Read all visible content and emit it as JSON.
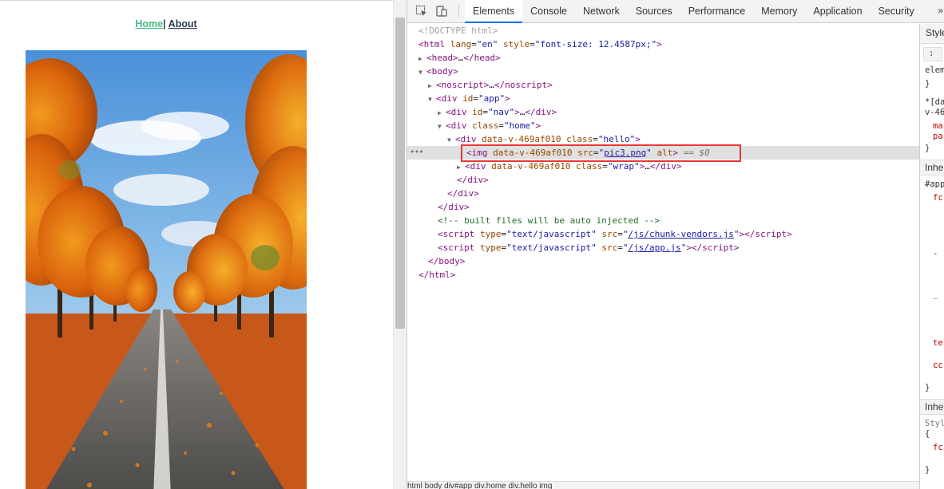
{
  "page": {
    "nav": {
      "home": "Home",
      "separator": "|",
      "about": "About"
    }
  },
  "devtools": {
    "tabs": [
      "Elements",
      "Console",
      "Network",
      "Sources",
      "Performance",
      "Memory",
      "Application",
      "Security"
    ],
    "more": "»",
    "tree": {
      "doctype": "<!DOCTYPE html>",
      "html_tag": "html",
      "html_lang": "en",
      "html_style": "font-size: 12.4587px;",
      "head": "head",
      "body": "body",
      "noscript": "noscript",
      "div": "div",
      "app_id": "app",
      "nav_id": "nav",
      "home_class": "home",
      "hello_attr": "data-v-469af010",
      "hello_class": "hello",
      "img_tag": "img",
      "img_src": "pic3.png",
      "img_eq": "== $0",
      "wrap_class": "wrap",
      "comment": "<!-- built files will be auto injected -->",
      "script_type": "text/javascript",
      "script1_src": "/js/chunk-vendors.js",
      "script2_src": "/js/app.js",
      "ellipsis": "…"
    },
    "styles": {
      "tab": "Styles",
      "lines": [
        ":",
        "elem",
        "}",
        "*[da",
        "v-46",
        "ma",
        "pa",
        "}",
        "#app",
        "fc",
        "-",
        "—",
        "te",
        "cc",
        "}",
        "Styl",
        "{",
        "fc",
        "}"
      ],
      "inherited": [
        "Inher",
        "Inher"
      ]
    },
    "crumbs": "html body div#app div.home div.hello img"
  }
}
